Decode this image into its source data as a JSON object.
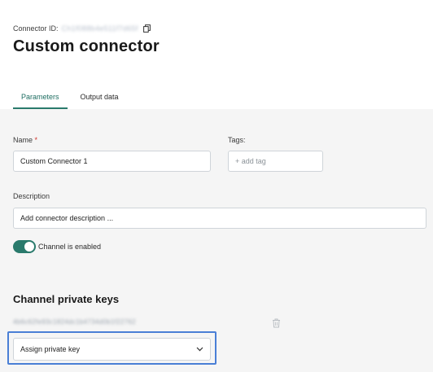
{
  "header": {
    "connector_id_label": "Connector ID:",
    "connector_id_value": "Ch1f088b4e511f7d65f",
    "title": "Custom connector"
  },
  "tabs": [
    {
      "label": "Parameters",
      "active": true
    },
    {
      "label": "Output data",
      "active": false
    }
  ],
  "form": {
    "name_label": "Name",
    "required_marker": "*",
    "name_value": "Custom Connector 1",
    "tags_label": "Tags:",
    "tags_placeholder": "+ add tag",
    "description_label": "Description",
    "description_placeholder": "Add connector description ...",
    "channel_toggle_label": "Channel is enabled",
    "channel_enabled": true
  },
  "private_keys": {
    "section_title": "Channel private keys",
    "key_value": "4b6c62fe93c1824dc1b4734d0b1f22762",
    "assign_label": "Assign private key"
  },
  "colors": {
    "accent": "#2a7a6c",
    "required": "#d0342c",
    "highlight": "#4a7fd6"
  },
  "icons": {
    "copy": "copy-icon",
    "trash": "trash-icon",
    "chevron": "chevron-down-icon"
  }
}
